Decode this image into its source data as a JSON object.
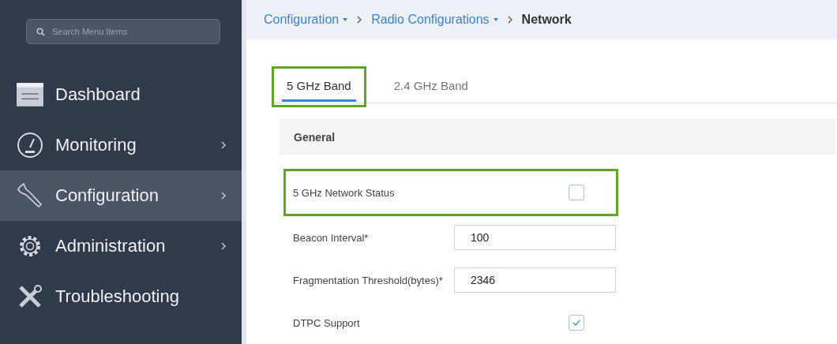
{
  "sidebar": {
    "search": {
      "placeholder": "Search Menu Items"
    },
    "items": [
      {
        "label": "Dashboard",
        "has_submenu": false,
        "selected": false
      },
      {
        "label": "Monitoring",
        "has_submenu": true,
        "selected": false
      },
      {
        "label": "Configuration",
        "has_submenu": true,
        "selected": true
      },
      {
        "label": "Administration",
        "has_submenu": true,
        "selected": false
      },
      {
        "label": "Troubleshooting",
        "has_submenu": false,
        "selected": false
      }
    ]
  },
  "breadcrumb": [
    {
      "label": "Configuration",
      "kind": "link",
      "dropdown": true
    },
    {
      "label": "Radio Configurations",
      "kind": "link",
      "dropdown": true
    },
    {
      "label": "Network",
      "kind": "current",
      "dropdown": false
    }
  ],
  "tabs": [
    {
      "label": "5 GHz Band",
      "selected": true,
      "highlighted": true
    },
    {
      "label": "2.4 GHz Band",
      "selected": false,
      "highlighted": false
    }
  ],
  "section": {
    "title": "General"
  },
  "fields": [
    {
      "label": "5 GHz Network Status",
      "kind": "checkbox",
      "checked": false,
      "highlighted": true
    },
    {
      "label": "Beacon Interval*",
      "kind": "text",
      "value": "100",
      "highlighted": false
    },
    {
      "label": "Fragmentation Threshold(bytes)*",
      "kind": "text",
      "value": "2346",
      "highlighted": false
    },
    {
      "label": "DTPC Support",
      "kind": "checkbox",
      "checked": true,
      "highlighted": false
    }
  ]
}
